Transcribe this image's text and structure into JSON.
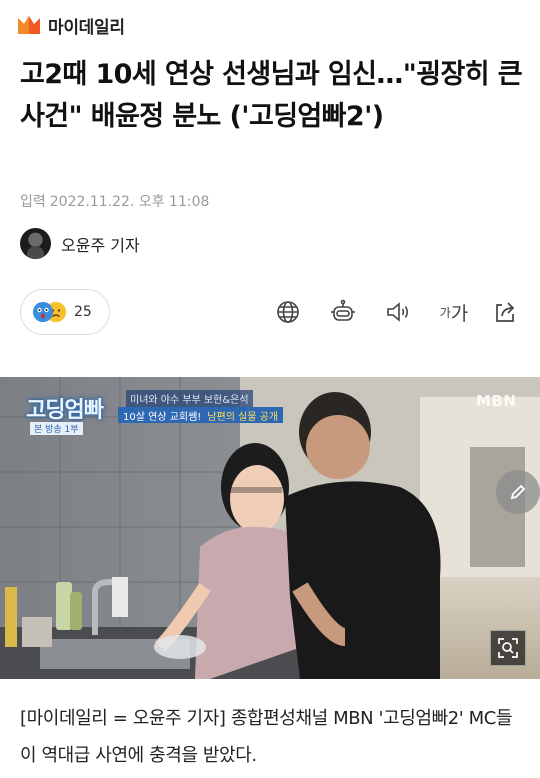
{
  "brand": {
    "name": "마이데일리",
    "icon": "maeil-logo-icon",
    "color": "#f05a23"
  },
  "article": {
    "title": "고2때 10세 연상 선생님과 임신…\"굉장히 큰 사건\" 배윤정 분노 ('고딩엄빠2')",
    "date_label": "입력",
    "date_value": "2022.11.22. 오후 11:08",
    "author": "오윤주 기자",
    "body": "[마이데일리 = 오윤주 기자] 종합편성채널 MBN '고딩엄빠2' MC들이 역대급 사연에 충격을 받았다."
  },
  "reactions": {
    "count": "25",
    "icons": [
      "shocked-face-icon",
      "sad-face-icon"
    ]
  },
  "toolbar": {
    "items": [
      "globe-icon",
      "robot-summary-icon",
      "speaker-icon",
      "font-size-icon",
      "share-icon"
    ],
    "font_label_small": "가",
    "font_label_large": "가"
  },
  "photo": {
    "show_logo": "고딩엄빠",
    "caption_top": "미녀와 야수 부부 보현&은석",
    "caption_main": "10살 연상 교회쌤!",
    "caption_highlight": "남편의 실물 공개",
    "episode_tag": "본 방송 1부",
    "broadcaster": "MBN"
  }
}
